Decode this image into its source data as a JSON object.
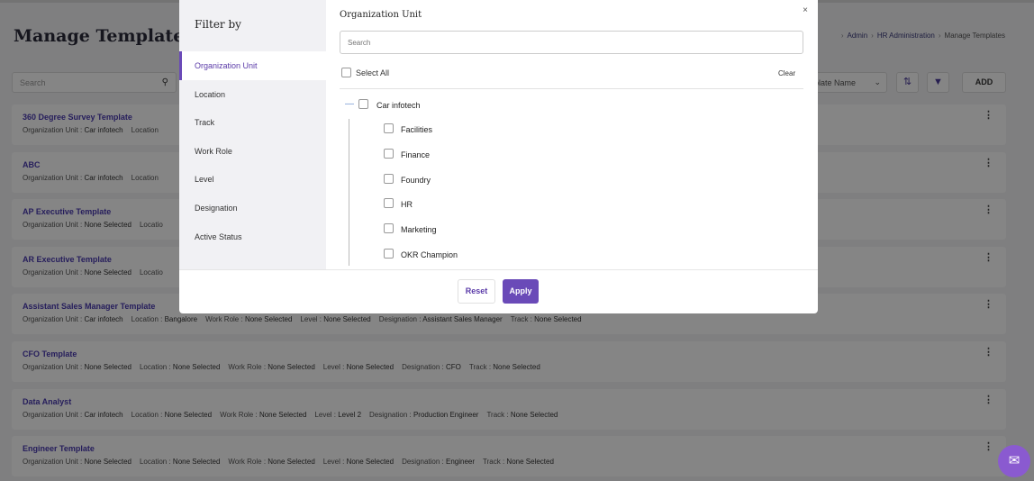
{
  "page": {
    "title": "Manage Templates",
    "breadcrumb": [
      "Admin",
      "HR Administration",
      "Manage Templates"
    ],
    "search_placeholder": "Search",
    "sort_label": "plate Name",
    "add_label": "ADD"
  },
  "templates": [
    {
      "name": "360 Degree Survey Template",
      "meta": [
        [
          "Organization Unit :",
          "Car infotech"
        ],
        [
          "Location",
          ""
        ]
      ]
    },
    {
      "name": "ABC",
      "meta": [
        [
          "Organization Unit :",
          "Car infotech"
        ],
        [
          "Location",
          ""
        ]
      ]
    },
    {
      "name": "AP Executive Template",
      "meta": [
        [
          "Organization Unit :",
          "None Selected"
        ],
        [
          "Locatio",
          ""
        ]
      ]
    },
    {
      "name": "AR Executive Template",
      "meta": [
        [
          "Organization Unit :",
          "None Selected"
        ],
        [
          "Locatio",
          ""
        ]
      ]
    },
    {
      "name": "Assistant Sales Manager Template",
      "meta": [
        [
          "Organization Unit :",
          "Car infotech"
        ],
        [
          "Location :",
          "Bangalore"
        ],
        [
          "Work Role :",
          "None Selected"
        ],
        [
          "Level :",
          "None Selected"
        ],
        [
          "Designation :",
          "Assistant Sales Manager"
        ],
        [
          "Track :",
          "None Selected"
        ]
      ]
    },
    {
      "name": "CFO Template",
      "meta": [
        [
          "Organization Unit :",
          "None Selected"
        ],
        [
          "Location :",
          "None Selected"
        ],
        [
          "Work Role :",
          "None Selected"
        ],
        [
          "Level :",
          "None Selected"
        ],
        [
          "Designation :",
          "CFO"
        ],
        [
          "Track :",
          "None Selected"
        ]
      ]
    },
    {
      "name": "Data Analyst",
      "meta": [
        [
          "Organization Unit :",
          "Car infotech"
        ],
        [
          "Location :",
          "None Selected"
        ],
        [
          "Work Role :",
          "None Selected"
        ],
        [
          "Level :",
          "Level 2"
        ],
        [
          "Designation :",
          "Production Engineer"
        ],
        [
          "Track :",
          "None Selected"
        ]
      ]
    },
    {
      "name": "Engineer Template",
      "meta": [
        [
          "Organization Unit :",
          "None Selected"
        ],
        [
          "Location :",
          "None Selected"
        ],
        [
          "Work Role :",
          "None Selected"
        ],
        [
          "Level :",
          "None Selected"
        ],
        [
          "Designation :",
          "Engineer"
        ],
        [
          "Track :",
          "None Selected"
        ]
      ]
    }
  ],
  "filter": {
    "title": "Filter by",
    "categories": [
      "Organization Unit",
      "Location",
      "Track",
      "Work Role",
      "Level",
      "Designation",
      "Active Status"
    ],
    "active_category": "Organization Unit",
    "pane_title": "Organization Unit",
    "search_placeholder": "Search",
    "select_all_label": "Select All",
    "clear_label": "Clear",
    "tree": {
      "root": "Car infotech",
      "children": [
        "Facilities",
        "Finance",
        "Foundry",
        "HR",
        "Marketing",
        "OKR Champion"
      ]
    },
    "reset_label": "Reset",
    "apply_label": "Apply",
    "close_symbol": "×"
  },
  "icons": {
    "search": "search-icon",
    "sort": "sort-icon",
    "filter": "filter-icon",
    "kebab": "kebab-icon",
    "chat": "chat-icon",
    "collapse": "minus-icon"
  },
  "colors": {
    "accent": "#6a4ab8",
    "link": "#4a3ab0"
  }
}
